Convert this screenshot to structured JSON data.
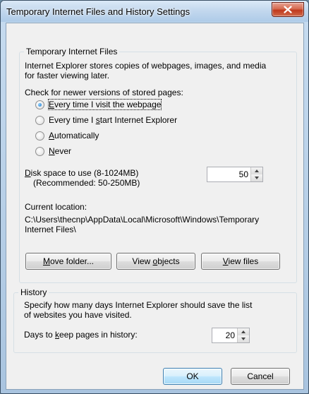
{
  "window": {
    "title": "Temporary Internet Files and History Settings"
  },
  "temp_files": {
    "legend": "Temporary Internet Files",
    "description": [
      "Internet Explorer stores copies of webpages, images, and media",
      "for faster viewing later."
    ],
    "check_label": "Check for newer versions of stored pages:",
    "options": [
      {
        "pre": "",
        "key": "E",
        "post": "very time I visit the webpage",
        "checked": true
      },
      {
        "pre": "Every time I ",
        "key": "s",
        "post": "tart Internet Explorer",
        "checked": false
      },
      {
        "pre": "",
        "key": "A",
        "post": "utomatically",
        "checked": false
      },
      {
        "pre": "",
        "key": "N",
        "post": "ever",
        "checked": false
      }
    ],
    "disk_label": {
      "pre": "",
      "key": "D",
      "post": "isk space to use (8-1024MB)"
    },
    "disk_recommended": "(Recommended: 50-250MB)",
    "disk_value": "50",
    "location_label": "Current location:",
    "location_path": [
      "C:\\Users\\thecnp\\AppData\\Local\\Microsoft\\Windows\\Temporary",
      "Internet Files\\"
    ],
    "buttons": {
      "move": {
        "pre": "",
        "key": "M",
        "post": "ove folder..."
      },
      "objects": {
        "pre": "View ",
        "key": "o",
        "post": "bjects"
      },
      "files": {
        "pre": "",
        "key": "V",
        "post": "iew files"
      }
    }
  },
  "history": {
    "legend": "History",
    "description": [
      "Specify how many days Internet Explorer should save the list",
      "of websites you have visited."
    ],
    "days_label": {
      "pre": "Days to ",
      "key": "k",
      "post": "eep pages in history:"
    },
    "days_value": "20"
  },
  "footer": {
    "ok": "OK",
    "cancel": "Cancel"
  },
  "colors": {
    "accent": "#3c7fb1",
    "close_button": "#c0391c",
    "dialog_bg": "#f0f0f0"
  }
}
